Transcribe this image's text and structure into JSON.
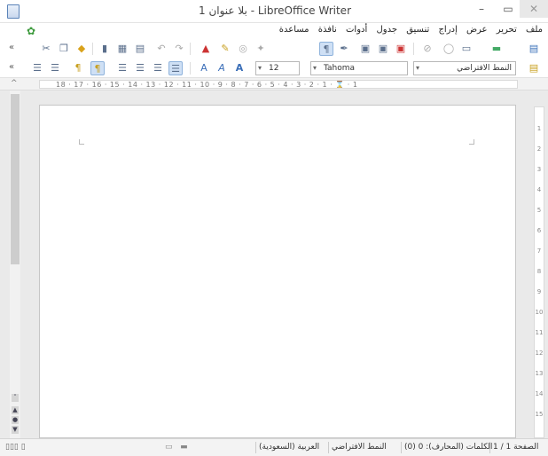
{
  "window": {
    "title": "بلا عنوان 1 - LibreOffice Writer",
    "minimize_glyph": "–",
    "maximize_glyph": "▭",
    "close_glyph": "✕"
  },
  "menu": {
    "items": [
      "ملف",
      "تحرير",
      "عرض",
      "إدراج",
      "تنسيق",
      "جدول",
      "أدوات",
      "نافذة",
      "مساعدة"
    ]
  },
  "toolbar2": {
    "font_size": "12",
    "font_name": "Tahoma",
    "paragraph_style": "النمط الافتراضي"
  },
  "ruler": {
    "scale": "18 · 17 · 16 · 15 · 14 · 13 · 12 · 11 · 10 · 9 · 8 · 7 · 6 · 5 · 4 · 3 · 2 · 1 · ⌛ · 1"
  },
  "vruler": {
    "numbers": [
      "1",
      "2",
      "3",
      "4",
      "5",
      "6",
      "7",
      "8",
      "9",
      "10",
      "11",
      "12",
      "13",
      "14",
      "15"
    ]
  },
  "status": {
    "page": "الصفحة 1 / 1",
    "words": "الكلمات (المحارف): 0 (0)",
    "style": "النمط الافتراضي",
    "language": "العربية (السعودية)",
    "left_text": "▯▯▯ ▯"
  }
}
